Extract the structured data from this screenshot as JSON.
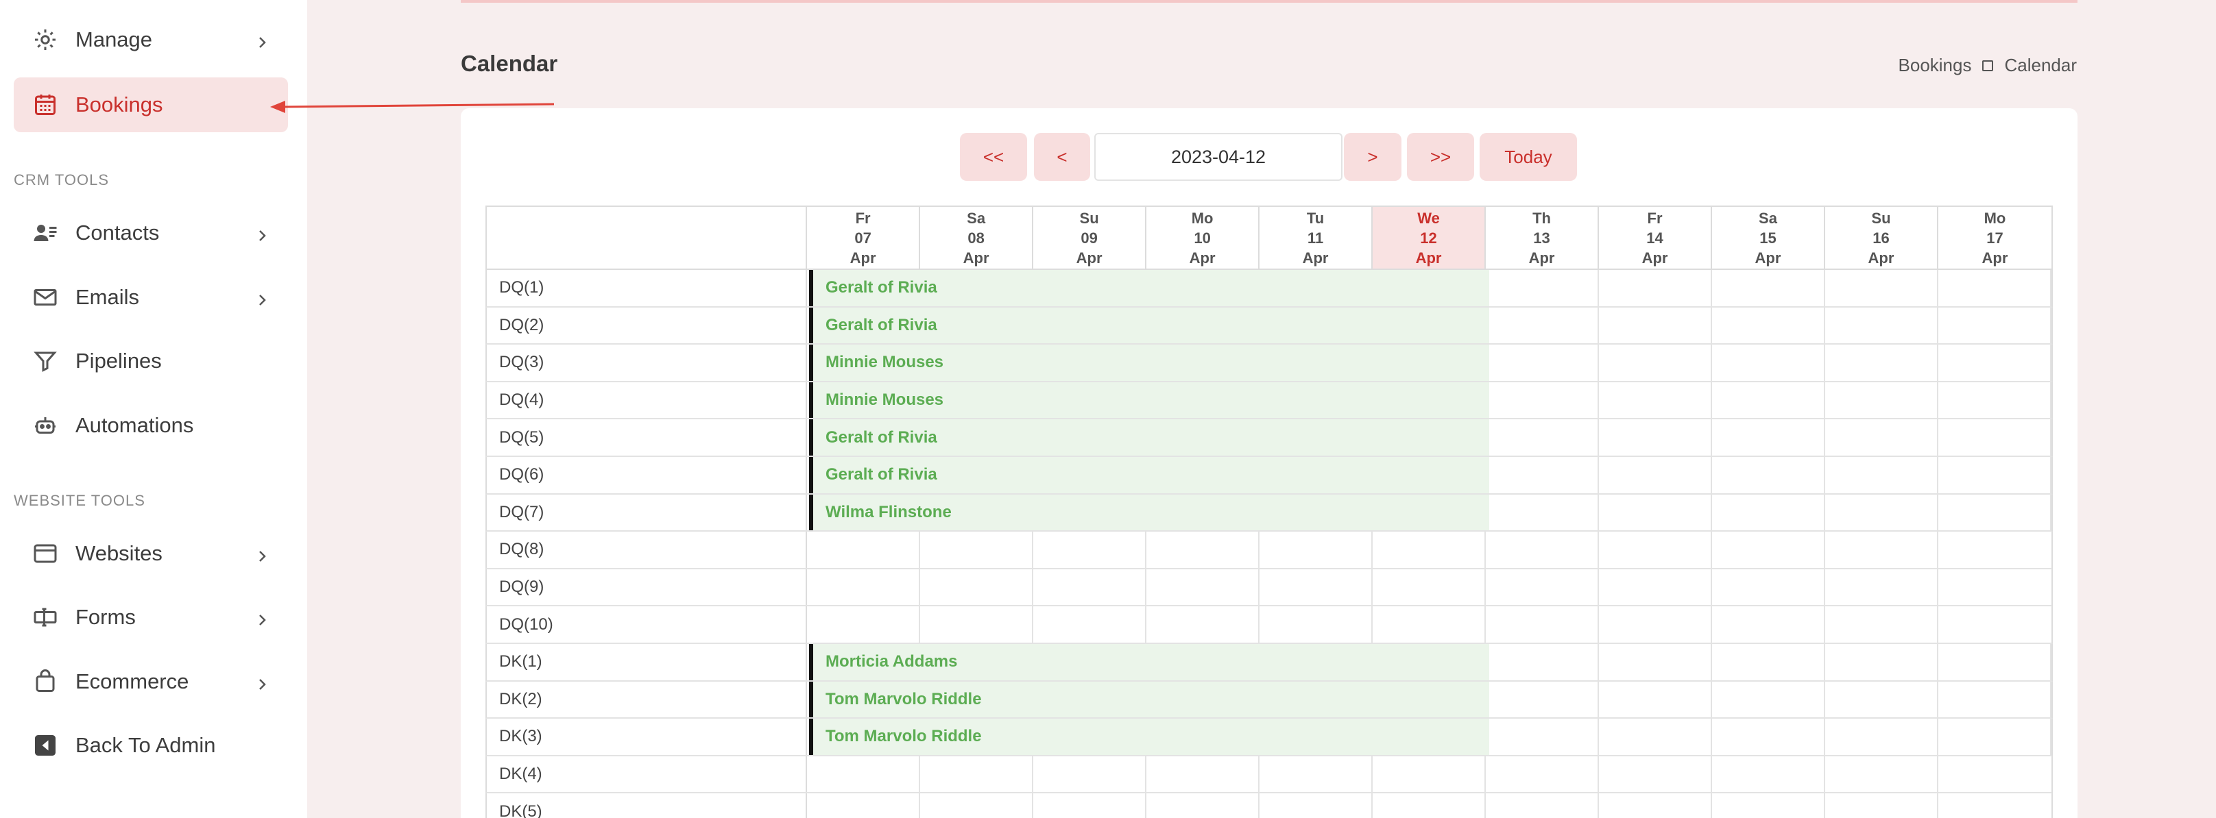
{
  "sidebar": {
    "items_top": [
      {
        "label": "Manage",
        "icon": "gear-icon",
        "chevron": true
      },
      {
        "label": "Bookings",
        "icon": "calendar-icon",
        "chevron": false,
        "active": true
      }
    ],
    "sections": [
      {
        "title": "CRM TOOLS",
        "items": [
          {
            "label": "Contacts",
            "icon": "contacts-icon",
            "chevron": true
          },
          {
            "label": "Emails",
            "icon": "envelope-icon",
            "chevron": true
          },
          {
            "label": "Pipelines",
            "icon": "funnel-icon",
            "chevron": false
          },
          {
            "label": "Automations",
            "icon": "robot-icon",
            "chevron": false
          }
        ]
      },
      {
        "title": "WEBSITE TOOLS",
        "items": [
          {
            "label": "Websites",
            "icon": "browser-icon",
            "chevron": true
          },
          {
            "label": "Forms",
            "icon": "form-icon",
            "chevron": true
          },
          {
            "label": "Ecommerce",
            "icon": "bag-icon",
            "chevron": true
          },
          {
            "label": "Back To Admin",
            "icon": "back-icon",
            "chevron": false
          }
        ]
      }
    ]
  },
  "header": {
    "title": "Calendar",
    "breadcrumb": [
      "Bookings",
      "Calendar"
    ]
  },
  "calendar_nav": {
    "first": "<<",
    "prev": "<",
    "date_value": "2023-04-12",
    "next": ">",
    "last": ">>",
    "today": "Today"
  },
  "calendar": {
    "days": [
      {
        "dow": "Fr",
        "day": "07",
        "month": "Apr"
      },
      {
        "dow": "Sa",
        "day": "08",
        "month": "Apr"
      },
      {
        "dow": "Su",
        "day": "09",
        "month": "Apr"
      },
      {
        "dow": "Mo",
        "day": "10",
        "month": "Apr"
      },
      {
        "dow": "Tu",
        "day": "11",
        "month": "Apr"
      },
      {
        "dow": "We",
        "day": "12",
        "month": "Apr",
        "today": true
      },
      {
        "dow": "Th",
        "day": "13",
        "month": "Apr"
      },
      {
        "dow": "Fr",
        "day": "14",
        "month": "Apr"
      },
      {
        "dow": "Sa",
        "day": "15",
        "month": "Apr"
      },
      {
        "dow": "Su",
        "day": "16",
        "month": "Apr"
      },
      {
        "dow": "Mo",
        "day": "17",
        "month": "Apr"
      }
    ],
    "rows": [
      {
        "label": "DQ(1)",
        "booking": "Geralt of Rivia"
      },
      {
        "label": "DQ(2)",
        "booking": "Geralt of Rivia"
      },
      {
        "label": "DQ(3)",
        "booking": "Minnie Mouses"
      },
      {
        "label": "DQ(4)",
        "booking": "Minnie Mouses"
      },
      {
        "label": "DQ(5)",
        "booking": "Geralt of Rivia"
      },
      {
        "label": "DQ(6)",
        "booking": "Geralt of Rivia"
      },
      {
        "label": "DQ(7)",
        "booking": "Wilma Flinstone"
      },
      {
        "label": "DQ(8)",
        "booking": ""
      },
      {
        "label": "DQ(9)",
        "booking": ""
      },
      {
        "label": "DQ(10)",
        "booking": ""
      },
      {
        "label": "DK(1)",
        "booking": "Morticia Addams"
      },
      {
        "label": "DK(2)",
        "booking": "Tom Marvolo Riddle"
      },
      {
        "label": "DK(3)",
        "booking": "Tom Marvolo Riddle"
      },
      {
        "label": "DK(4)",
        "booking": ""
      },
      {
        "label": "DK(5)",
        "booking": ""
      }
    ]
  },
  "colors": {
    "accent": "#c9302c",
    "booking_text": "#5cad53",
    "booking_bg": "#ebf5ea"
  }
}
